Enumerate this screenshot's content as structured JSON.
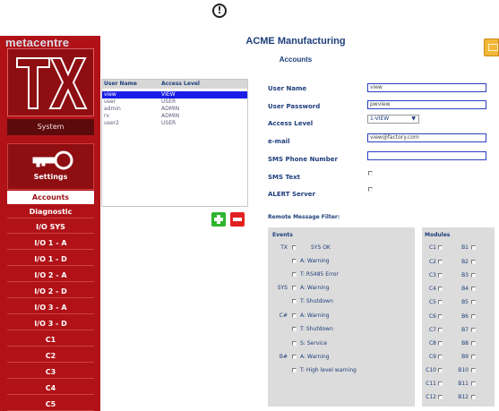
{
  "alert_icon": "exclamation-circle-icon",
  "brand": {
    "name": "metacentre",
    "logo_text": "TX"
  },
  "sidebar": {
    "system_label": "System",
    "settings_label": "Settings",
    "items": [
      {
        "label": "Accounts",
        "active": true
      },
      {
        "label": "Diagnostic"
      },
      {
        "label": "I/O SYS"
      },
      {
        "label": "I/O 1 - A"
      },
      {
        "label": "I/O 1 - D"
      },
      {
        "label": "I/O 2 - A"
      },
      {
        "label": "I/O 2 - D"
      },
      {
        "label": "I/O 3 - A"
      },
      {
        "label": "I/O 3 - D"
      },
      {
        "label": "C1"
      },
      {
        "label": "C2"
      },
      {
        "label": "C3"
      },
      {
        "label": "C4"
      },
      {
        "label": "C5"
      }
    ]
  },
  "header": {
    "title": "ACME Manufacturing",
    "subtitle": "Accounts"
  },
  "users_table": {
    "columns": [
      "User Name",
      "Access Level"
    ],
    "rows": [
      {
        "name": "view",
        "level": "VIEW",
        "selected": true
      },
      {
        "name": "user",
        "level": "USER"
      },
      {
        "name": "admin",
        "level": "ADMIN"
      },
      {
        "name": "rv",
        "level": "ADMIN"
      },
      {
        "name": "user2",
        "level": "USER"
      }
    ]
  },
  "form": {
    "user_name_label": "User Name",
    "user_name_value": "view",
    "password_label": "User Password",
    "password_value": "pwview",
    "access_level_label": "Access Level",
    "access_level_value": "1-VIEW",
    "email_label": "e-mail",
    "email_value": "view@factory.com",
    "sms_phone_label": "SMS Phone Number",
    "sms_phone_value": "",
    "sms_text_label": "SMS Text",
    "alert_server_label": "ALERT Server"
  },
  "filter": {
    "title": "Remote Message Filter:",
    "events_heading": "Events",
    "modules_heading": "Modules",
    "events": [
      {
        "group": "TX",
        "label": "SYS OK"
      },
      {
        "group": "",
        "label": "A: Warning"
      },
      {
        "group": "",
        "label": "T: RS485 Error"
      },
      {
        "group": "SYS",
        "label": "A: Warning"
      },
      {
        "group": "",
        "label": "T: Shutdown"
      },
      {
        "group": "C#",
        "label": "A: Warning"
      },
      {
        "group": "",
        "label": "T: Shutdown"
      },
      {
        "group": "",
        "label": "S: Service"
      },
      {
        "group": "B#",
        "label": "A: Warning"
      },
      {
        "group": "",
        "label": "T: High level warning"
      }
    ],
    "modules": [
      {
        "c": "C1",
        "b": "B1"
      },
      {
        "c": "C2",
        "b": "B2"
      },
      {
        "c": "C3",
        "b": "B3"
      },
      {
        "c": "C4",
        "b": "B4"
      },
      {
        "c": "C5",
        "b": "B5"
      },
      {
        "c": "C6",
        "b": "B6"
      },
      {
        "c": "C7",
        "b": "B7"
      },
      {
        "c": "C8",
        "b": "B8"
      },
      {
        "c": "C9",
        "b": "B9"
      },
      {
        "c": "C10",
        "b": "B10"
      },
      {
        "c": "C11",
        "b": "B11"
      },
      {
        "c": "C12",
        "b": "B12"
      }
    ]
  },
  "colors": {
    "sidebar_red": "#b01218",
    "title_blue": "#1d3e7a",
    "selection_blue": "#1b1ee6",
    "add_green": "#2fb52f",
    "delete_red": "#e22222"
  }
}
